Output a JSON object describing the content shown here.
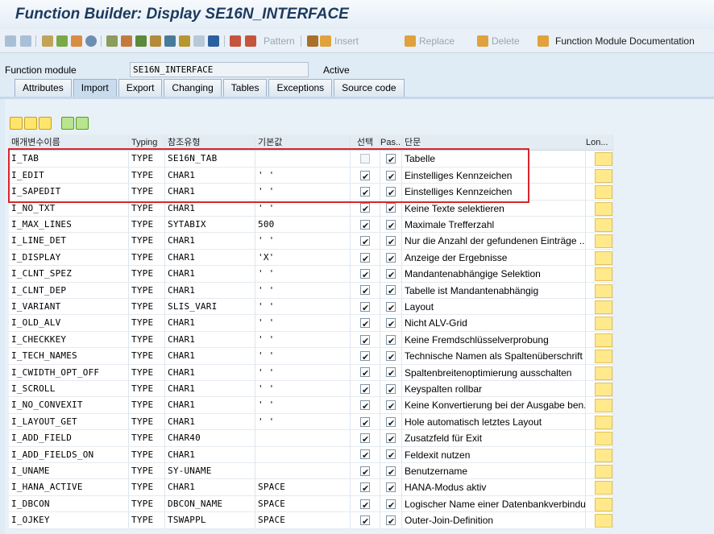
{
  "window": {
    "title": "Function Builder: Display SE16N_INTERFACE"
  },
  "toolbar": {
    "pattern_label": "Pattern",
    "insert_label": "Insert",
    "replace_label": "Replace",
    "delete_label": "Delete",
    "doc_label": "Function Module Documentation"
  },
  "header": {
    "function_module_label": "Function module",
    "function_module_value": "SE16N_INTERFACE",
    "status": "Active"
  },
  "tabs": [
    {
      "label": "Attributes"
    },
    {
      "label": "Import"
    },
    {
      "label": "Export"
    },
    {
      "label": "Changing"
    },
    {
      "label": "Tables"
    },
    {
      "label": "Exceptions"
    },
    {
      "label": "Source code"
    }
  ],
  "active_tab": "Import",
  "table": {
    "columns": [
      "매개변수이름",
      "Typing",
      "참조유형",
      "기본값",
      "선택",
      "Pas...",
      "단문",
      "Lon..."
    ],
    "rows": [
      {
        "name": "I_TAB",
        "typing": "TYPE",
        "ref": "SE16N_TAB",
        "default": "",
        "optional": false,
        "optional_disabled": true,
        "pass": true,
        "text": "Tabelle"
      },
      {
        "name": "I_EDIT",
        "typing": "TYPE",
        "ref": "CHAR1",
        "default": "' '",
        "optional": true,
        "pass": true,
        "text": "Einstelliges Kennzeichen"
      },
      {
        "name": "I_SAPEDIT",
        "typing": "TYPE",
        "ref": "CHAR1",
        "default": "' '",
        "optional": true,
        "pass": true,
        "text": "Einstelliges Kennzeichen"
      },
      {
        "name": "I_NO_TXT",
        "typing": "TYPE",
        "ref": "CHAR1",
        "default": "' '",
        "optional": true,
        "pass": true,
        "text": "Keine Texte selektieren"
      },
      {
        "name": "I_MAX_LINES",
        "typing": "TYPE",
        "ref": "SYTABIX",
        "default": "500",
        "optional": true,
        "pass": true,
        "text": "Maximale Trefferzahl"
      },
      {
        "name": "I_LINE_DET",
        "typing": "TYPE",
        "ref": "CHAR1",
        "default": "' '",
        "optional": true,
        "pass": true,
        "text": "Nur die Anzahl der gefundenen Einträge ..."
      },
      {
        "name": "I_DISPLAY",
        "typing": "TYPE",
        "ref": "CHAR1",
        "default": "'X'",
        "optional": true,
        "pass": true,
        "text": "Anzeige der Ergebnisse"
      },
      {
        "name": "I_CLNT_SPEZ",
        "typing": "TYPE",
        "ref": "CHAR1",
        "default": "' '",
        "optional": true,
        "pass": true,
        "text": "Mandantenabhängige Selektion"
      },
      {
        "name": "I_CLNT_DEP",
        "typing": "TYPE",
        "ref": "CHAR1",
        "default": "' '",
        "optional": true,
        "pass": true,
        "text": "Tabelle ist Mandantenabhängig"
      },
      {
        "name": "I_VARIANT",
        "typing": "TYPE",
        "ref": "SLIS_VARI",
        "default": "' '",
        "optional": true,
        "pass": true,
        "text": "Layout"
      },
      {
        "name": "I_OLD_ALV",
        "typing": "TYPE",
        "ref": "CHAR1",
        "default": "' '",
        "optional": true,
        "pass": true,
        "text": "Nicht ALV-Grid"
      },
      {
        "name": "I_CHECKKEY",
        "typing": "TYPE",
        "ref": "CHAR1",
        "default": "' '",
        "optional": true,
        "pass": true,
        "text": "Keine Fremdschlüsselverprobung"
      },
      {
        "name": "I_TECH_NAMES",
        "typing": "TYPE",
        "ref": "CHAR1",
        "default": "' '",
        "optional": true,
        "pass": true,
        "text": "Technische Namen als Spaltenüberschrift"
      },
      {
        "name": "I_CWIDTH_OPT_OFF",
        "typing": "TYPE",
        "ref": "CHAR1",
        "default": "' '",
        "optional": true,
        "pass": true,
        "text": "Spaltenbreitenoptimierung ausschalten"
      },
      {
        "name": "I_SCROLL",
        "typing": "TYPE",
        "ref": "CHAR1",
        "default": "' '",
        "optional": true,
        "pass": true,
        "text": "Keyspalten rollbar"
      },
      {
        "name": "I_NO_CONVEXIT",
        "typing": "TYPE",
        "ref": "CHAR1",
        "default": "' '",
        "optional": true,
        "pass": true,
        "text": "Keine Konvertierung bei der Ausgabe ben.."
      },
      {
        "name": "I_LAYOUT_GET",
        "typing": "TYPE",
        "ref": "CHAR1",
        "default": "' '",
        "optional": true,
        "pass": true,
        "text": "Hole automatisch letztes Layout"
      },
      {
        "name": "I_ADD_FIELD",
        "typing": "TYPE",
        "ref": "CHAR40",
        "default": "",
        "optional": true,
        "pass": true,
        "text": "Zusatzfeld für Exit"
      },
      {
        "name": "I_ADD_FIELDS_ON",
        "typing": "TYPE",
        "ref": "CHAR1",
        "default": "",
        "optional": true,
        "pass": true,
        "text": "Feldexit nutzen"
      },
      {
        "name": "I_UNAME",
        "typing": "TYPE",
        "ref": "SY-UNAME",
        "default": "",
        "optional": true,
        "pass": true,
        "text": "Benutzername"
      },
      {
        "name": "I_HANA_ACTIVE",
        "typing": "TYPE",
        "ref": "CHAR1",
        "default": "SPACE",
        "optional": true,
        "pass": true,
        "text": "HANA-Modus aktiv"
      },
      {
        "name": "I_DBCON",
        "typing": "TYPE",
        "ref": "DBCON_NAME",
        "default": "SPACE",
        "optional": true,
        "pass": true,
        "text": "Logischer Name einer Datenbankverbindu.."
      },
      {
        "name": "I_OJKEY",
        "typing": "TYPE",
        "ref": "TSWAPPL",
        "default": "SPACE",
        "optional": true,
        "pass": true,
        "text": "Outer-Join-Definition"
      }
    ]
  },
  "colors": {
    "title": "#1c3a5e",
    "highlight_box": "#d9262c",
    "long_text_button": "#ffe98a",
    "background": "#dfebf5"
  }
}
